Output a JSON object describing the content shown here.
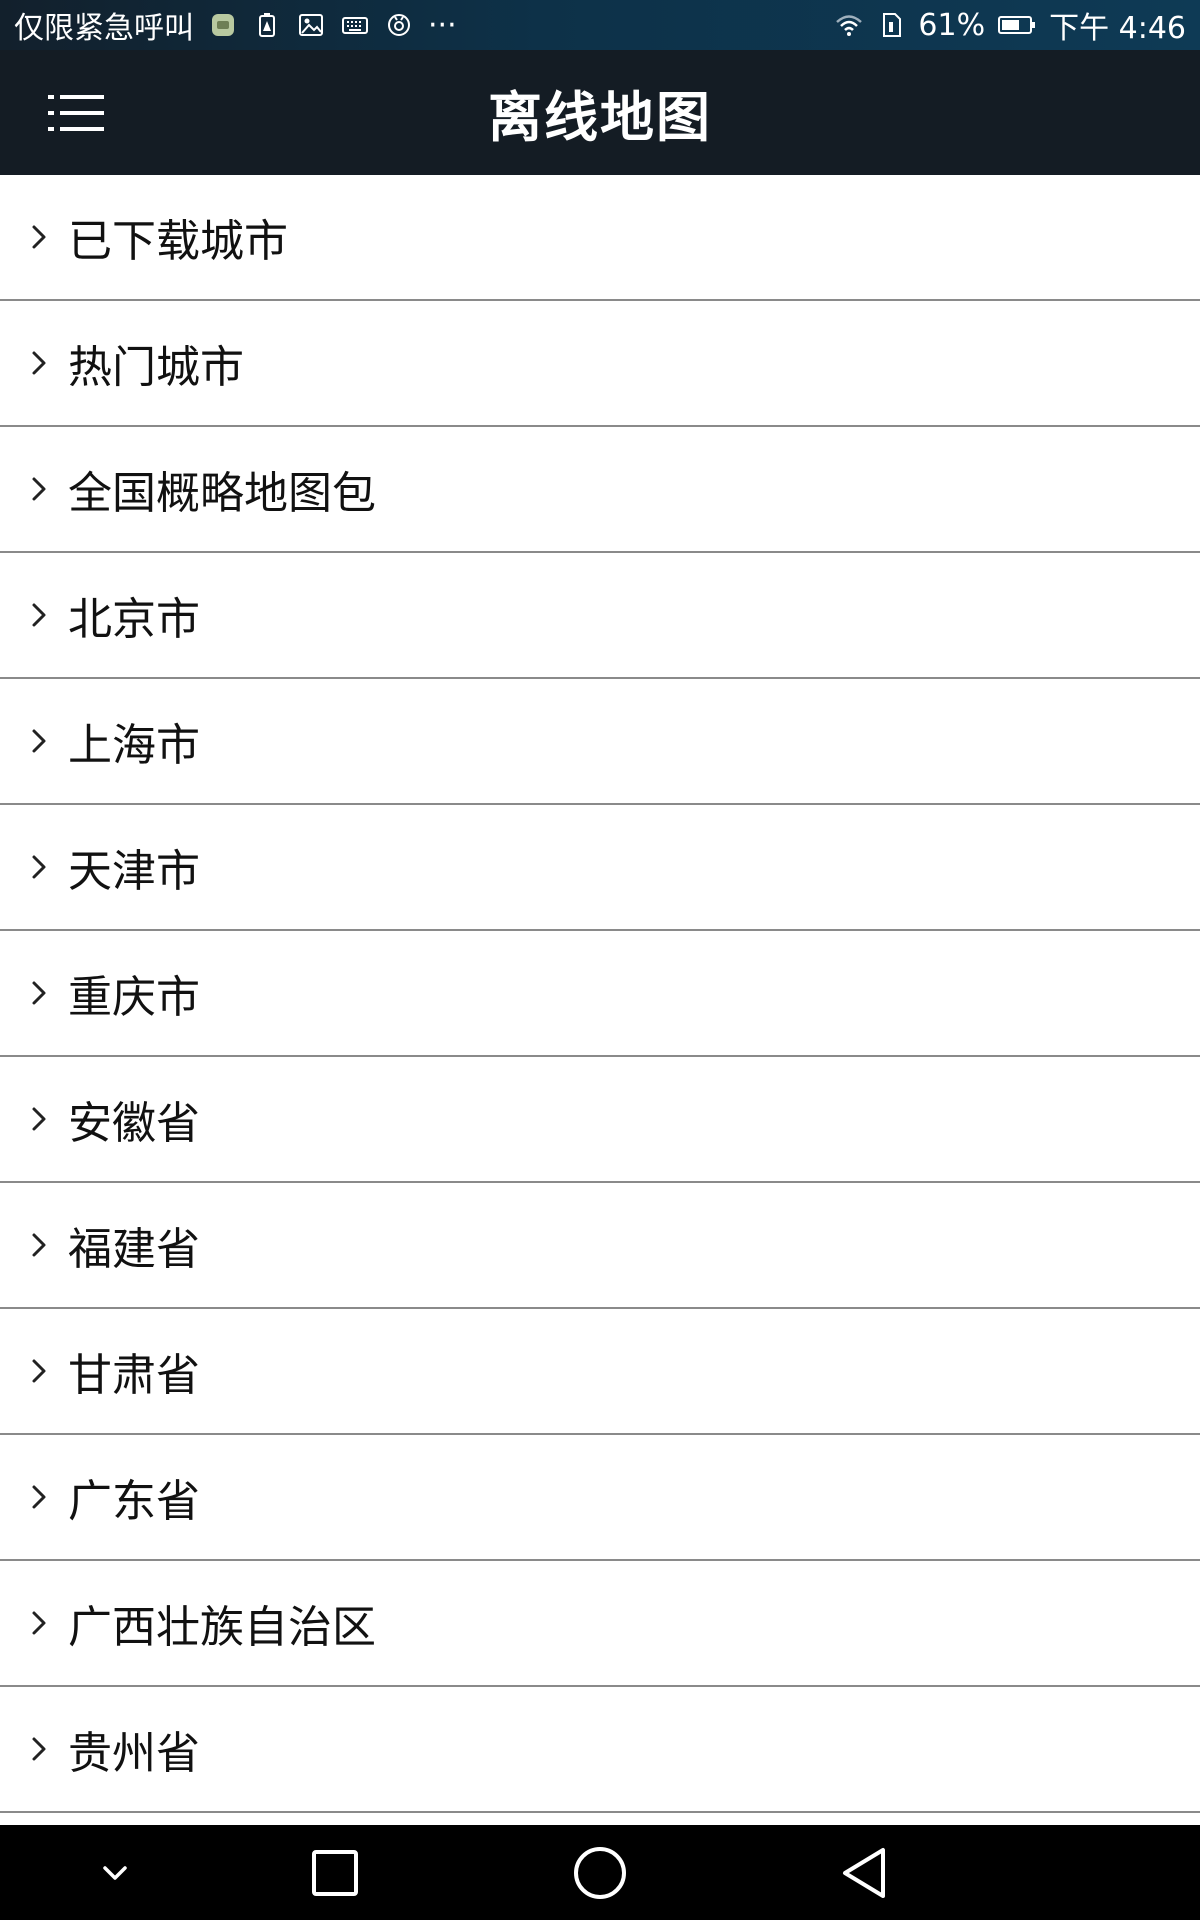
{
  "status_bar": {
    "carrier_text": "仅限紧急呼叫",
    "more_text": "···",
    "battery_percent": "61%",
    "time": "下午 4:46"
  },
  "header": {
    "title": "离线地图"
  },
  "city_list": [
    {
      "label": "已下载城市"
    },
    {
      "label": "热门城市"
    },
    {
      "label": "全国概略地图包"
    },
    {
      "label": "北京市"
    },
    {
      "label": "上海市"
    },
    {
      "label": "天津市"
    },
    {
      "label": "重庆市"
    },
    {
      "label": "安徽省"
    },
    {
      "label": "福建省"
    },
    {
      "label": "甘肃省"
    },
    {
      "label": "广东省"
    },
    {
      "label": "广西壮族自治区"
    },
    {
      "label": "贵州省"
    }
  ],
  "icons": {
    "menu": "hamburger-menu-icon",
    "row": "chevron-right-icon",
    "nav": [
      "chevron-down-icon",
      "square-recents-icon",
      "circle-home-icon",
      "triangle-back-icon"
    ]
  },
  "colors": {
    "app_bar": "#141c24",
    "status_bar": "#0e3a55",
    "nav_bar": "#000000",
    "divider": "#8a8a8a"
  }
}
